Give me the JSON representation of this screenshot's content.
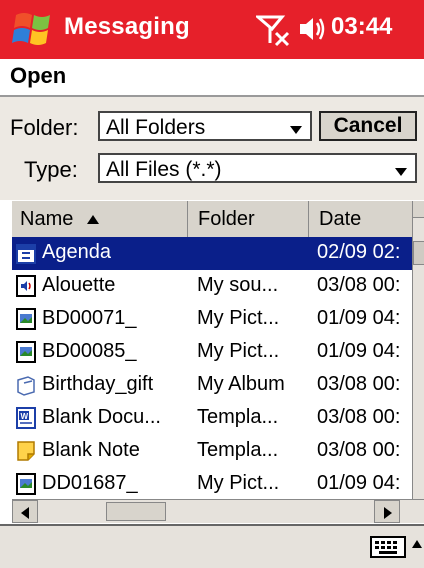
{
  "titlebar": {
    "app_title": "Messaging",
    "clock": "03:44",
    "colors": {
      "accent": "#e6202a"
    }
  },
  "dialog": {
    "title": "Open",
    "folder_label": "Folder:",
    "folder_value": "All Folders",
    "type_label": "Type:",
    "type_value": "All Files (*.*)",
    "cancel_label": "Cancel"
  },
  "list": {
    "columns": [
      "Name",
      "Folder",
      "Date"
    ],
    "rows": [
      {
        "name": "Agenda",
        "folder": "",
        "date": "02/09 02:",
        "icon": "calendar-icon",
        "selected": true
      },
      {
        "name": "Alouette",
        "folder": "My sou...",
        "date": "03/08 00:",
        "icon": "sound-file-icon"
      },
      {
        "name": "BD00071_",
        "folder": "My Pict...",
        "date": "01/09 04:",
        "icon": "picture-file-icon"
      },
      {
        "name": "BD00085_",
        "folder": "My Pict...",
        "date": "01/09 04:",
        "icon": "picture-file-icon"
      },
      {
        "name": "Birthday_gift",
        "folder": "My Album",
        "date": "03/08 00:",
        "icon": "album-icon"
      },
      {
        "name": "Blank Docu...",
        "folder": "Templa...",
        "date": "03/08 00:",
        "icon": "word-document-icon"
      },
      {
        "name": "Blank Note",
        "folder": "Templa...",
        "date": "03/08 00:",
        "icon": "note-icon"
      },
      {
        "name": "DD01687_",
        "folder": "My Pict...",
        "date": "01/09 04:",
        "icon": "picture-file-icon"
      }
    ]
  }
}
